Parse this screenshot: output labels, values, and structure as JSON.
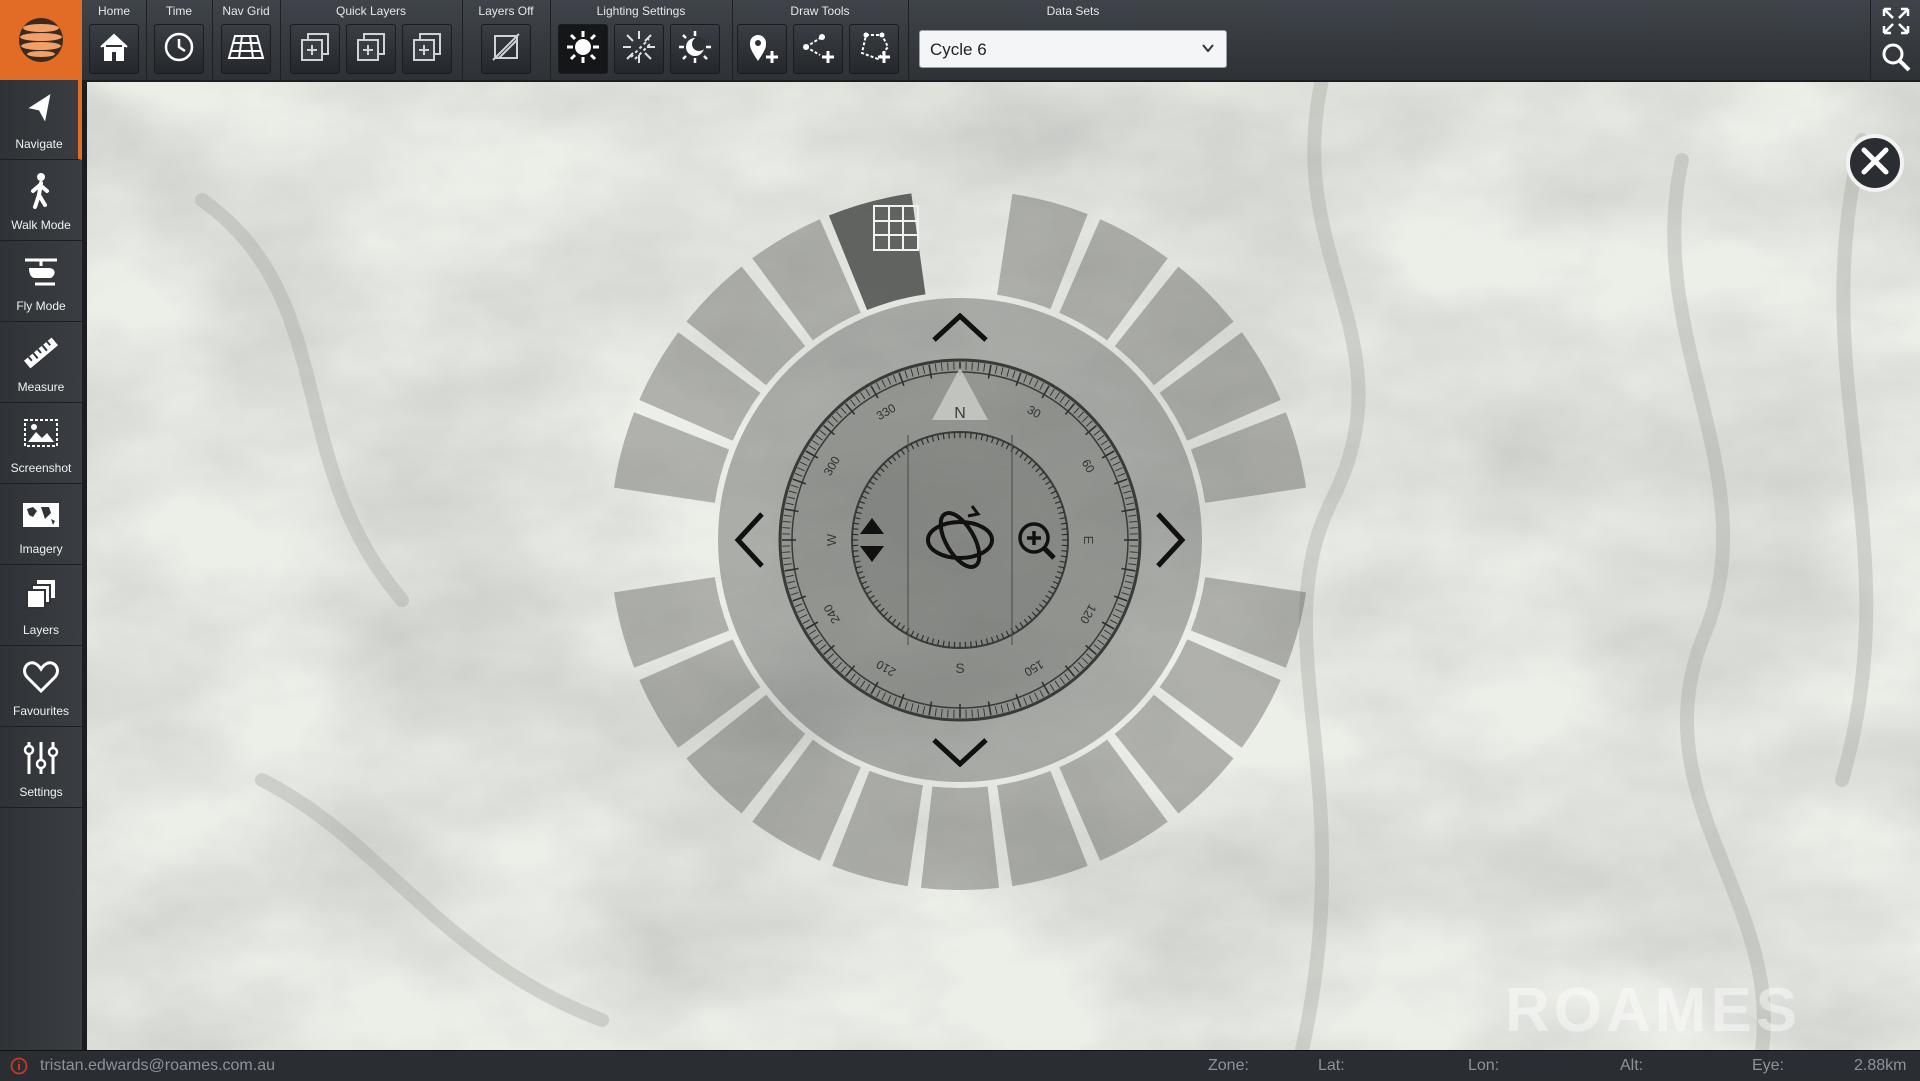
{
  "app": {
    "logo_icon": "globe-icon",
    "accent_color": "#e26b25"
  },
  "toolbar": {
    "groups": [
      {
        "label": "Home",
        "buttons": [
          {
            "icon": "home-icon"
          }
        ]
      },
      {
        "label": "Time",
        "buttons": [
          {
            "icon": "clock-icon"
          }
        ]
      },
      {
        "label": "Nav Grid",
        "buttons": [
          {
            "icon": "grid-plane-icon"
          }
        ]
      },
      {
        "label": "Quick Layers",
        "buttons": [
          {
            "icon": "layer-1-icon"
          },
          {
            "icon": "layer-2-icon"
          },
          {
            "icon": "layer-3-icon"
          }
        ]
      },
      {
        "label": "Layers Off",
        "buttons": [
          {
            "icon": "layers-off-icon"
          }
        ]
      },
      {
        "label": "Lighting Settings",
        "buttons": [
          {
            "icon": "sun-icon",
            "active": true
          },
          {
            "icon": "sun-rays-icon"
          },
          {
            "icon": "moon-sun-icon"
          }
        ]
      },
      {
        "label": "Draw Tools",
        "buttons": [
          {
            "icon": "add-point-icon"
          },
          {
            "icon": "add-line-icon"
          },
          {
            "icon": "add-polygon-icon"
          }
        ]
      },
      {
        "label": "Data Sets"
      }
    ],
    "dataset_value": "Cycle 6",
    "right_icons": [
      "fullscreen-icon",
      "search-icon"
    ]
  },
  "sidebar": {
    "items": [
      {
        "label": "Navigate",
        "icon": "navigate-arrow-icon",
        "active": true
      },
      {
        "label": "Walk Mode",
        "icon": "walking-person-icon"
      },
      {
        "label": "Fly Mode",
        "icon": "helicopter-icon"
      },
      {
        "label": "Measure",
        "icon": "ruler-icon"
      },
      {
        "label": "Screenshot",
        "icon": "screenshot-icon"
      },
      {
        "label": "Imagery",
        "icon": "world-map-icon"
      },
      {
        "label": "Layers",
        "icon": "stacked-layers-icon"
      },
      {
        "label": "Favourites",
        "icon": "heart-icon"
      },
      {
        "label": "Settings",
        "icon": "sliders-icon"
      }
    ]
  },
  "compass": {
    "cardinals": {
      "n": "N",
      "e": "E",
      "s": "S",
      "w": "W"
    },
    "degree_labels": [
      "30",
      "60",
      "120",
      "150",
      "210",
      "240",
      "300",
      "330"
    ],
    "controls": [
      "pan-up-arrow",
      "pan-down-arrow",
      "pan-left-arrow",
      "pan-right-arrow",
      "elevation-icon",
      "orbit-icon",
      "zoom-in-icon",
      "grid-toggle-icon"
    ]
  },
  "status": {
    "user": "tristan.edwards@roames.com.au",
    "zone_label": "Zone:",
    "lat_label": "Lat:",
    "lon_label": "Lon:",
    "alt_label": "Alt:",
    "eye_label": "Eye:",
    "eye_value": "2.88km"
  },
  "watermark": "ROAMES"
}
